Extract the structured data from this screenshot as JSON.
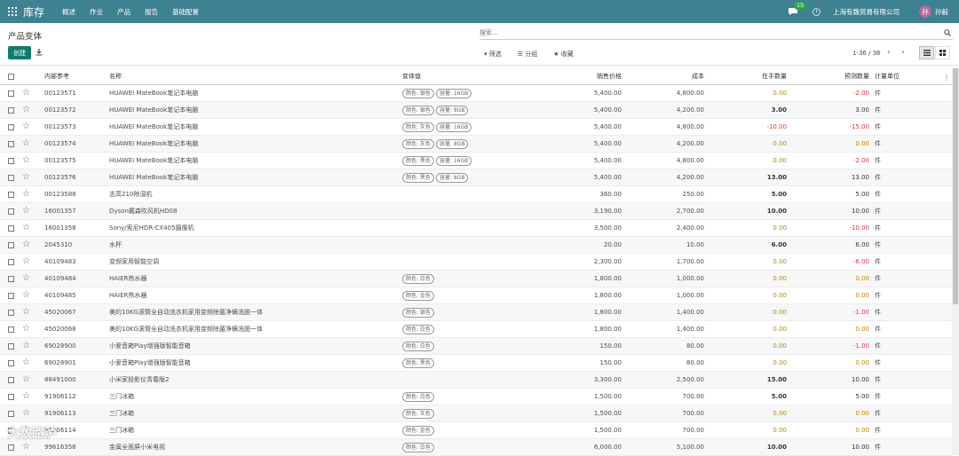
{
  "navbar": {
    "brand": "库存",
    "menu": [
      "概述",
      "作业",
      "产品",
      "报告",
      "基础配置"
    ],
    "chat_badge": "15",
    "company": "上海有魏贸易有限公司",
    "avatar_letter": "孙",
    "username": "孙毅",
    "color": "#3e8291"
  },
  "control": {
    "title": "产品变体",
    "search_placeholder": "搜索...",
    "create_label": "创建",
    "filter_label": "筛选",
    "group_label": "分组",
    "fav_label": "收藏",
    "pager": "1-36 / 36"
  },
  "table": {
    "headers": {
      "ref": "内部参考",
      "name": "名称",
      "variants": "变体值",
      "price": "销售价格",
      "cost": "成本",
      "onhand": "在手数量",
      "forecast": "预测数量",
      "uom": "计量单位"
    },
    "rows": [
      {
        "ref": "00123571",
        "name": "HUAWEI MateBook笔记本电脑",
        "tags": [
          "颜色: 银色",
          "容量: 16GB"
        ],
        "price": "5,400.00",
        "cost": "4,800.00",
        "onhand": "0.00",
        "forecast": "-2.00",
        "uom": "件"
      },
      {
        "ref": "00123572",
        "name": "HUAWEI MateBook笔记本电脑",
        "tags": [
          "颜色: 银色",
          "容量: 8GB"
        ],
        "price": "5,400.00",
        "cost": "4,200.00",
        "onhand": "3.00",
        "forecast": "3.00",
        "uom": "件"
      },
      {
        "ref": "00123573",
        "name": "HUAWEI MateBook笔记本电脑",
        "tags": [
          "颜色: 灰色",
          "容量: 16GB"
        ],
        "price": "5,400.00",
        "cost": "4,800.00",
        "onhand": "-10.00",
        "forecast": "-15.00",
        "uom": "件"
      },
      {
        "ref": "00123574",
        "name": "HUAWEI MateBook笔记本电脑",
        "tags": [
          "颜色: 灰色",
          "容量: 8GB"
        ],
        "price": "5,400.00",
        "cost": "4,200.00",
        "onhand": "0.00",
        "forecast": "0.00",
        "uom": "件"
      },
      {
        "ref": "00123575",
        "name": "HUAWEI MateBook笔记本电脑",
        "tags": [
          "颜色: 黑色",
          "容量: 16GB"
        ],
        "price": "5,400.00",
        "cost": "4,800.00",
        "onhand": "0.00",
        "forecast": "-2.00",
        "uom": "件"
      },
      {
        "ref": "00123576",
        "name": "HUAWEI MateBook笔记本电脑",
        "tags": [
          "颜色: 黑色",
          "容量: 8GB"
        ],
        "price": "5,400.00",
        "cost": "4,200.00",
        "onhand": "13.00",
        "forecast": "13.00",
        "uom": "件"
      },
      {
        "ref": "00123588",
        "name": "志高210除湿机",
        "tags": [],
        "price": "360.00",
        "cost": "250.00",
        "onhand": "5.00",
        "forecast": "5.00",
        "uom": "件"
      },
      {
        "ref": "16001357",
        "name": "Dyson戴森吹风机HD08",
        "tags": [],
        "price": "3,190.00",
        "cost": "2,700.00",
        "onhand": "10.00",
        "forecast": "10.00",
        "uom": "件"
      },
      {
        "ref": "16001358",
        "name": "Sony/索尼HDR-CX405摄像机",
        "tags": [],
        "price": "3,500.00",
        "cost": "2,400.00",
        "onhand": "0.00",
        "forecast": "-10.00",
        "uom": "件"
      },
      {
        "ref": "2045310",
        "name": "水杯",
        "tags": [],
        "price": "20.00",
        "cost": "10.00",
        "onhand": "6.00",
        "forecast": "6.00",
        "uom": "件"
      },
      {
        "ref": "40109483",
        "name": "变频家用智能空调",
        "tags": [],
        "price": "2,300.00",
        "cost": "1,700.00",
        "onhand": "0.00",
        "forecast": "-6.00",
        "uom": "件"
      },
      {
        "ref": "40109484",
        "name": "HAIER热水器",
        "tags": [
          "颜色: 白色"
        ],
        "price": "1,800.00",
        "cost": "1,000.00",
        "onhand": "0.00",
        "forecast": "0.00",
        "uom": "件"
      },
      {
        "ref": "40109485",
        "name": "HAIER热水器",
        "tags": [
          "颜色: 金色"
        ],
        "price": "1,800.00",
        "cost": "1,000.00",
        "onhand": "0.00",
        "forecast": "0.00",
        "uom": "件"
      },
      {
        "ref": "45020067",
        "name": "美的10KG滚筒全自动洗衣机家用变频除菌净螨洗脱一体",
        "tags": [
          "颜色: 银色"
        ],
        "price": "1,800.00",
        "cost": "1,400.00",
        "onhand": "0.00",
        "forecast": "-1.00",
        "uom": "件"
      },
      {
        "ref": "45020068",
        "name": "美的10KG滚筒全自动洗衣机家用变频除菌净螨洗脱一体",
        "tags": [
          "颜色: 白色"
        ],
        "price": "1,800.00",
        "cost": "1,400.00",
        "onhand": "0.00",
        "forecast": "0.00",
        "uom": "件"
      },
      {
        "ref": "69028900",
        "name": "小爱音箱Play增强版智能音箱",
        "tags": [
          "颜色: 白色"
        ],
        "price": "150.00",
        "cost": "80.00",
        "onhand": "0.00",
        "forecast": "-1.00",
        "uom": "件"
      },
      {
        "ref": "69028901",
        "name": "小爱音箱Play增强版智能音箱",
        "tags": [
          "颜色: 黑色"
        ],
        "price": "150.00",
        "cost": "80.00",
        "onhand": "0.00",
        "forecast": "0.00",
        "uom": "件"
      },
      {
        "ref": "88491000",
        "name": "小米家投影仪青春版2",
        "tags": [],
        "price": "3,300.00",
        "cost": "2,500.00",
        "onhand": "15.00",
        "forecast": "10.00",
        "uom": "件"
      },
      {
        "ref": "91906112",
        "name": "三门冰箱",
        "tags": [
          "颜色: 白色"
        ],
        "price": "1,500.00",
        "cost": "700.00",
        "onhand": "5.00",
        "forecast": "5.00",
        "uom": "件"
      },
      {
        "ref": "91906113",
        "name": "三门冰箱",
        "tags": [
          "颜色: 灰色"
        ],
        "price": "1,500.00",
        "cost": "700.00",
        "onhand": "0.00",
        "forecast": "0.00",
        "uom": "件"
      },
      {
        "ref": "91906114",
        "name": "三门冰箱",
        "tags": [
          "颜色: 金色"
        ],
        "price": "1,500.00",
        "cost": "700.00",
        "onhand": "0.00",
        "forecast": "0.00",
        "uom": "件"
      },
      {
        "ref": "99616358",
        "name": "金属全面屏小米电视",
        "tags": [
          "颜色: 白色"
        ],
        "price": "6,000.00",
        "cost": "5,100.00",
        "onhand": "10.00",
        "forecast": "10.00",
        "uom": "件"
      }
    ]
  },
  "watermark": "大数路泸"
}
